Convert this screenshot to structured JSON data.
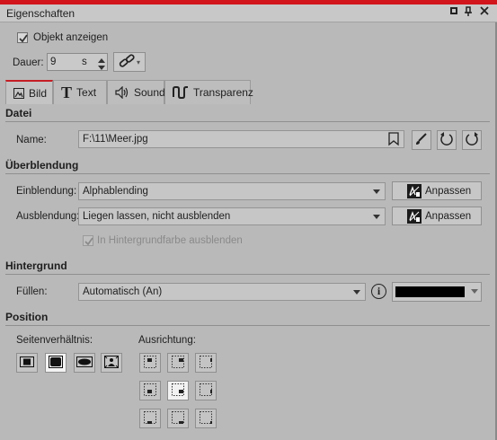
{
  "window": {
    "title": "Eigenschaften",
    "pin_glyph": "⊤",
    "close_glyph": "✕",
    "menu_glyph": "▪"
  },
  "object": {
    "show_label": "Objekt anzeigen",
    "show_checked": true
  },
  "duration": {
    "label": "Dauer:",
    "value": "9",
    "unit": "s"
  },
  "tabs": [
    {
      "label": "Bild",
      "icon": "image-icon",
      "active": true
    },
    {
      "label": "Text",
      "icon": "text-icon",
      "active": false
    },
    {
      "label": "Sound",
      "icon": "speaker-icon",
      "active": false
    },
    {
      "label": "Transparenz",
      "icon": "transparency-icon",
      "active": false
    }
  ],
  "file": {
    "section": "Datei",
    "name_label": "Name:",
    "name_value": "F:\\11\\Meer.jpg"
  },
  "transition": {
    "section": "Überblendung",
    "in_label": "Einblendung:",
    "in_value": "Alphablending",
    "out_label": "Ausblendung:",
    "out_value": "Liegen lassen, nicht ausblenden",
    "adjust_label": "Anpassen",
    "bg_fade_label": "In Hintergrundfarbe ausblenden",
    "bg_fade_checked": true
  },
  "background": {
    "section": "Hintergrund",
    "fill_label": "Füllen:",
    "fill_value": "Automatisch (An)",
    "info_glyph": "i",
    "color": "#000000"
  },
  "position": {
    "section": "Position",
    "aspect_label": "Seitenverhältnis:",
    "alignment_label": "Ausrichtung:",
    "aspect_selected": 1,
    "alignment_selected": 4
  },
  "colors": {
    "accent": "#d2141c",
    "panel": "#b9b9b9"
  }
}
